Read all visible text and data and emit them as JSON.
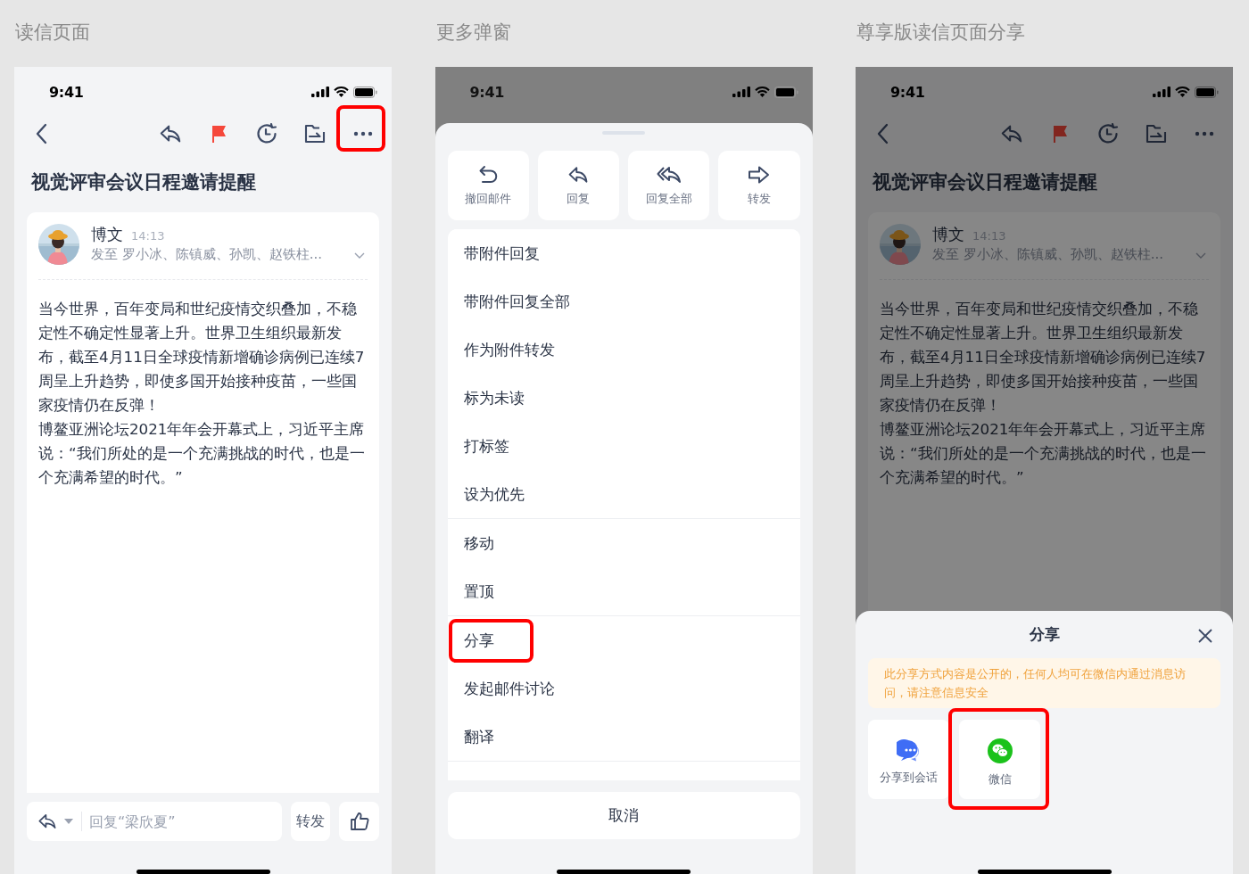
{
  "panels": [
    {
      "caption": "读信页面",
      "kind": "mail",
      "status_time": "9:41",
      "mail": {
        "flagged": true,
        "more_highlighted": true,
        "title": "视觉评审会议日程邀请提醒",
        "sender": "博文",
        "time": "14:13",
        "recipients": "发至 罗小冰、陈镇威、孙凯、赵铁柱...",
        "body": [
          "当今世界，百年变局和世纪疫情交织叠加，不稳定性不确定性显著上升。世界卫生组织最新发布，截至4月11日全球疫情新增确诊病例已连续7周呈上升趋势，即使多国开始接种疫苗，一些国家疫情仍在反弹！",
          "博鳌亚洲论坛2021年年会开幕式上，习近平主席说：“我们所处的是一个充满挑战的时代，也是一个充满希望的时代。”"
        ],
        "reply_bar": {
          "placeholder": "回复“梁欣夏”",
          "forward": "转发"
        }
      }
    },
    {
      "caption": "更多弹窗",
      "kind": "more_sheet",
      "status_time": "9:41",
      "actions": [
        {
          "kind": "recall",
          "label": "撤回邮件"
        },
        {
          "kind": "reply",
          "label": "回复"
        },
        {
          "kind": "reply_all",
          "label": "回复全部"
        },
        {
          "kind": "forward",
          "label": "转发"
        }
      ],
      "menu_groups": [
        [
          {
            "label": "带附件回复",
            "highlighted": false
          },
          {
            "label": "带附件回复全部",
            "highlighted": false
          },
          {
            "label": "作为附件转发",
            "highlighted": false
          },
          {
            "label": "标为未读",
            "highlighted": false
          },
          {
            "label": "打标签",
            "highlighted": false
          },
          {
            "label": "设为优先",
            "highlighted": false
          }
        ],
        [
          {
            "label": "移动",
            "highlighted": false
          },
          {
            "label": "置顶",
            "highlighted": false
          }
        ],
        [
          {
            "label": "分享",
            "highlighted": true
          },
          {
            "label": "发起邮件讨论",
            "highlighted": false
          },
          {
            "label": "翻译",
            "highlighted": false
          }
        ]
      ],
      "cancel": "取消"
    },
    {
      "caption": "尊享版读信页面分享",
      "kind": "share",
      "status_time": "9:41",
      "mail": {
        "flagged": true,
        "more_highlighted": false,
        "title": "视觉评审会议日程邀请提醒",
        "sender": "博文",
        "time": "14:13",
        "recipients": "发至 罗小冰、陈镇威、孙凯、赵铁柱...",
        "body": [
          "当今世界，百年变局和世纪疫情交织叠加，不稳定性不确定性显著上升。世界卫生组织最新发布，截至4月11日全球疫情新增确诊病例已连续7周呈上升趋势，即使多国开始接种疫苗，一些国家疫情仍在反弹！",
          "博鳌亚洲论坛2021年年会开幕式上，习近平主席说：“我们所处的是一个充满挑战的时代，也是一个充满希望的时代。”"
        ]
      },
      "share": {
        "title": "分享",
        "notice": "此分享方式内容是公开的，任何人均可在微信内通过消息访问，请注意信息安全",
        "options": [
          {
            "kind": "conversation",
            "label": "分享到会话",
            "highlighted": false
          },
          {
            "kind": "wechat",
            "label": "微信",
            "highlighted": true
          }
        ]
      }
    }
  ]
}
